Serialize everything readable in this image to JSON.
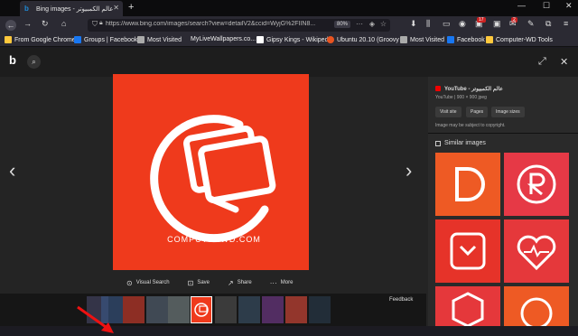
{
  "tab": {
    "title": "Bing images - عالم الكمبيوتر",
    "new_tab": "+"
  },
  "window": {
    "minimize": "—",
    "maximize": "☐",
    "close": "✕"
  },
  "nav": {
    "back": "←",
    "forward": "→",
    "reload": "↻",
    "url": "https://www.bing.com/images/search?view=detailV2&ccid=WyjG%2FIIN8...",
    "zoom": "80%",
    "badge_count_1": "17",
    "badge_count_2": "2"
  },
  "bookmarks": [
    {
      "label": "From Google Chrome",
      "color": "#ffc83d"
    },
    {
      "label": "Groups | Facebook",
      "color": "#1877f2"
    },
    {
      "label": "Most Visited",
      "color": "#aaaaaa"
    },
    {
      "label": "MyLiveWallpapers.co...",
      "color": "#2b2a33"
    },
    {
      "label": "Gipsy Kings - Wikipedia",
      "color": "#ffffff"
    },
    {
      "label": "Ubuntu 20.10 (Groovy ...",
      "color": "#e95420"
    },
    {
      "label": "Most Visited",
      "color": "#aaaaaa"
    },
    {
      "label": "Facebook",
      "color": "#1877f2"
    },
    {
      "label": "Computer-WD Tools",
      "color": "#ffc83d"
    }
  ],
  "viewer": {
    "watermark": "COMPUTERWD.COM",
    "actions": [
      {
        "icon": "⊙",
        "label": "Visual Search"
      },
      {
        "icon": "⊡",
        "label": "Save"
      },
      {
        "icon": "↗",
        "label": "Share"
      },
      {
        "icon": "···",
        "label": "More"
      }
    ],
    "feedback": "Feedback",
    "prev": "‹",
    "next": "›"
  },
  "panel": {
    "source_title": "YouTube - عالم الكمبيوتر",
    "source_meta": "YouTube | 900 × 900 jpeg",
    "buttons": [
      "Visit site",
      "Pages",
      "Image sizes"
    ],
    "copyright": "Image may be subject to copyright.",
    "similar_title": "Similar images"
  },
  "colors": {
    "accent": "#ef3a1c",
    "bg": "#242424",
    "panel": "#2a2a2a"
  }
}
